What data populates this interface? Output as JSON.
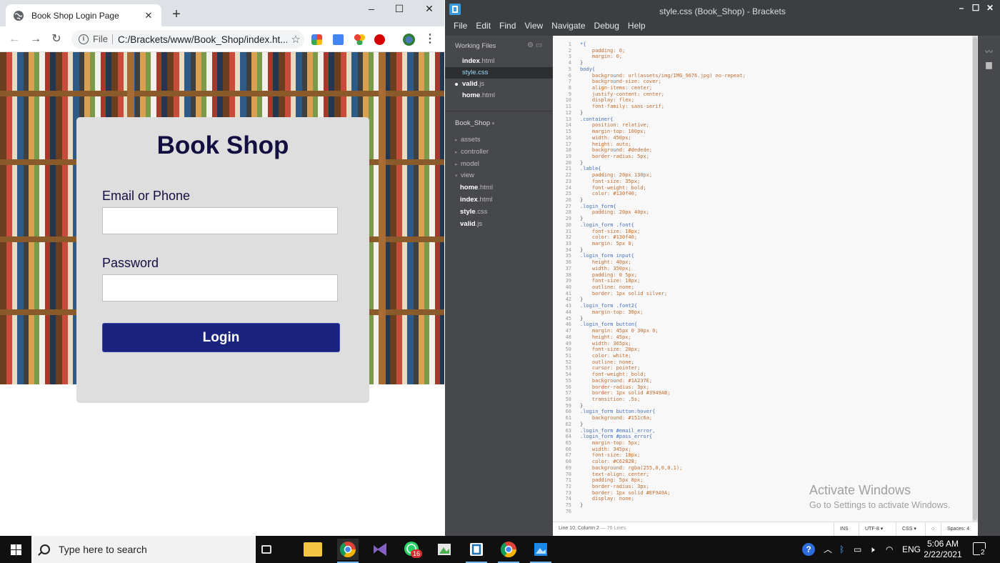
{
  "browser": {
    "tab_title": "Book Shop Login Page",
    "new_tab_symbol": "+",
    "address_scheme": "File",
    "address_url": "C:/Brackets/www/Book_Shop/index.ht...",
    "window_controls": [
      "–",
      "☐",
      "✕"
    ]
  },
  "page": {
    "heading": "Book Shop",
    "email_label": "Email or Phone",
    "password_label": "Password",
    "login_button": "Login"
  },
  "brackets": {
    "window_title": "style.css (Book_Shop) - Brackets",
    "menu": [
      "File",
      "Edit",
      "Find",
      "View",
      "Navigate",
      "Debug",
      "Help"
    ],
    "working_files_header": "Working Files",
    "working_files": [
      {
        "name": "index",
        "ext": ".html"
      },
      {
        "name": "style",
        "ext": ".css"
      },
      {
        "name": "valid",
        "ext": ".js"
      },
      {
        "name": "home",
        "ext": ".html"
      }
    ],
    "project_name": "Book_Shop",
    "tree_folders": [
      "assets",
      "controller",
      "model",
      "view"
    ],
    "tree_files": [
      {
        "name": "home",
        "ext": ".html"
      },
      {
        "name": "index",
        "ext": ".html"
      },
      {
        "name": "style",
        "ext": ".css"
      },
      {
        "name": "valid",
        "ext": ".js"
      }
    ],
    "status": {
      "position": "Line 10, Column 2",
      "lines": "— 76 Lines",
      "mode": "INS",
      "encoding": "UTF-8 ▾",
      "language": "CSS ▾",
      "spaces": "Spaces: 4"
    },
    "code_lines": [
      "*{",
      "    padding: 0;",
      "    margin: 0;",
      "}",
      "body{",
      "    background: url(assets/img/IMG_9676.jpg) no-repeat;",
      "    background-size: cover;",
      "    align-items: center;",
      "    justify-content: center;",
      "    display: flex;",
      "    font-family: sans-serif;",
      "}",
      ".container{",
      "    position: relative;",
      "    margin-top: 100px;",
      "    width: 450px;",
      "    height: auto;",
      "    background: #dedede;",
      "    border-radius: 5px;",
      "}",
      ".lable{",
      "    padding: 20px 130px;",
      "    font-size: 35px;",
      "    font-weight: bold;",
      "    color: #130f40;",
      "}",
      ".login_form{",
      "    padding: 20px 40px;",
      "}",
      ".login_form .font{",
      "    font-size: 18px;",
      "    color: #130f40;",
      "    margin: 5px 0;",
      "}",
      ".login_form input{",
      "    height: 40px;",
      "    width: 350px;",
      "    padding: 0 5px;",
      "    font-size: 18px;",
      "    outline: none;",
      "    border: 1px solid silver;",
      "}",
      ".login_form .font2{",
      "    margin-top: 30px;",
      "}",
      ".login_form button{",
      "    margin: 45px 0 30px 0;",
      "    height: 45px;",
      "    width: 365px;",
      "    font-size: 20px;",
      "    color: white;",
      "    outline: none;",
      "    cursor: pointer;",
      "    font-weight: bold;",
      "    background: #1A237E;",
      "    border-radius: 3px;",
      "    border: 1px solid #3949AB;",
      "    transition: .5s;",
      "}",
      ".login_form button:hover{",
      "    background: #151c6a;",
      "}",
      ".login_form #email_error,",
      ".login_form #pass_error{",
      "    margin-top: 5px;",
      "    width: 345px;",
      "    font-size: 18px;",
      "    color: #C62828;",
      "    background: rgba(255,0,0,0.1);",
      "    text-align: center;",
      "    padding: 5px 8px;",
      "    border-radius: 3px;",
      "    border: 1px solid #EF9A9A;",
      "    display: none;",
      "}",
      ""
    ]
  },
  "watermark": {
    "line1": "Activate Windows",
    "line2": "Go to Settings to activate Windows."
  },
  "taskbar": {
    "search_placeholder": "Type here to search",
    "language": "ENG",
    "time": "5:06 AM",
    "date": "2/22/2021",
    "whatsapp_badge": "16",
    "notification_count": "2"
  }
}
